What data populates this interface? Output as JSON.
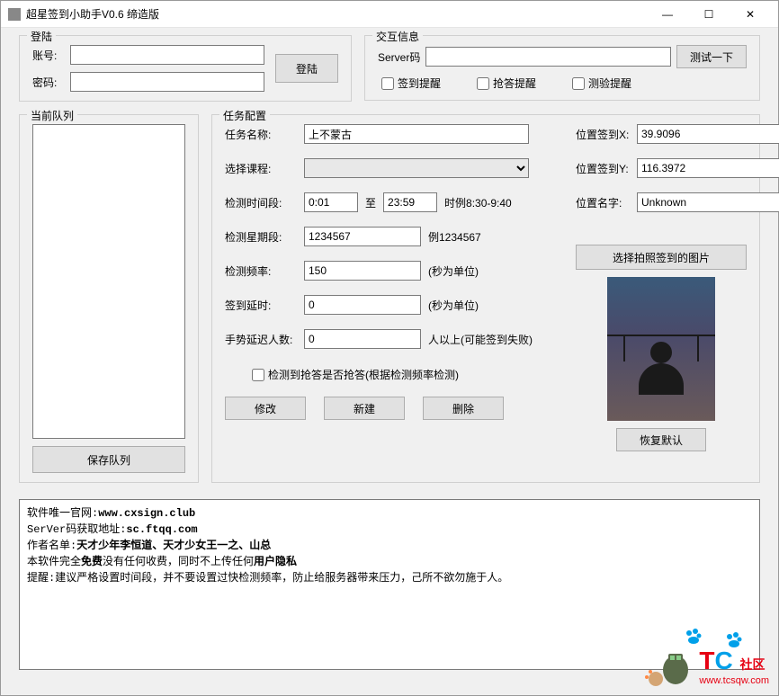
{
  "window": {
    "title": "超星签到小助手V0.6 缔造版"
  },
  "login": {
    "legend": "登陆",
    "account_label": "账号:",
    "password_label": "密码:",
    "login_btn": "登陆"
  },
  "interaction": {
    "legend": "交互信息",
    "server_label": "Server码",
    "test_btn": "测试一下",
    "sign_remind": "签到提醒",
    "answer_remind": "抢答提醒",
    "test_remind": "测验提醒"
  },
  "queue": {
    "legend": "当前队列",
    "save_btn": "保存队列"
  },
  "task": {
    "legend": "任务配置",
    "name_label": "任务名称:",
    "name_value": "上不蒙古",
    "course_label": "选择课程:",
    "time_label": "检测时间段:",
    "time_start": "0:01",
    "time_to": "至",
    "time_end": "23:59",
    "time_hint": "时例8:30-9:40",
    "week_label": "检测星期段:",
    "week_value": "1234567",
    "week_hint": "例1234567",
    "freq_label": "检测频率:",
    "freq_value": "150",
    "freq_hint": "(秒为单位)",
    "delay_label": "签到延时:",
    "delay_value": "0",
    "delay_hint": "(秒为单位)",
    "gesture_label": "手势延迟人数:",
    "gesture_value": "0",
    "gesture_hint": "人以上(可能签到失败)",
    "autograb_label": "检测到抢答是否抢答(根据检测频率检测)",
    "modify_btn": "修改",
    "new_btn": "新建",
    "delete_btn": "删除",
    "pos_x_label": "位置签到X:",
    "pos_x_value": "39.9096",
    "pos_y_label": "位置签到Y:",
    "pos_y_value": "116.3972",
    "pos_name_label": "位置名字:",
    "pos_name_value": "Unknown",
    "photo_btn": "选择拍照签到的图片",
    "restore_btn": "恢复默认"
  },
  "footer": {
    "l1a": "软件唯一官网:",
    "l1b": "www.cxsign.club",
    "l2a": "SerVer码获取地址:",
    "l2b": "sc.ftqq.com",
    "l3a": "作者名单:",
    "l3b": "天才少年李恒道、天才少女王一之、山总",
    "l4a": "本软件完全",
    "l4b": "免费",
    "l4c": "没有任何收费，同时不上传任何",
    "l4d": "用户隐私",
    "l5": "提醒:建议严格设置时间段，并不要设置过快检测频率，防止给服务器带来压力，己所不欲勿施于人。"
  },
  "watermark": {
    "community": "社区",
    "url": "www.tcsqw.com"
  }
}
